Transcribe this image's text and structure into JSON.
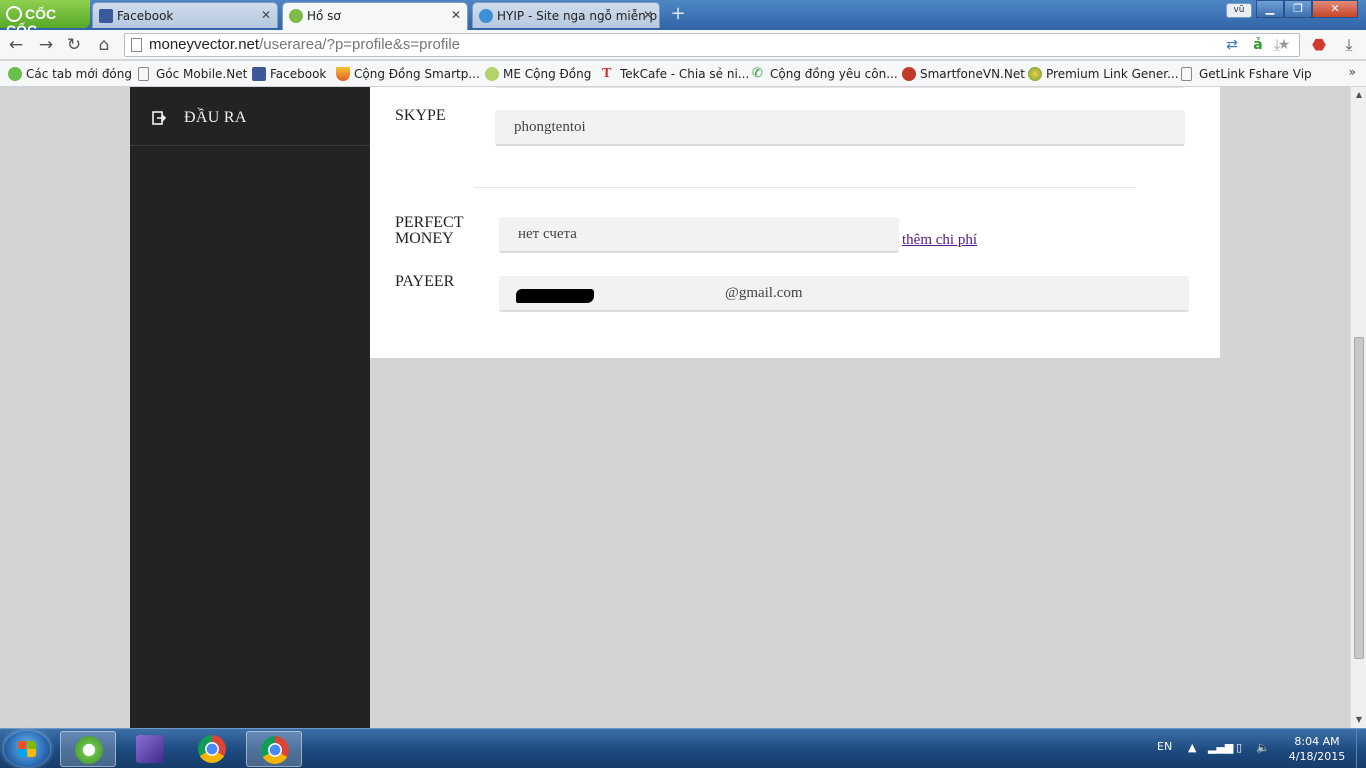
{
  "browser": {
    "brand": "CỐC CỐC",
    "tabs": [
      {
        "label": "Facebook",
        "active": false
      },
      {
        "label": "Hồ sơ",
        "active": true
      },
      {
        "label": "HYIP - Site nga ngỗ miễn p",
        "active": false
      }
    ],
    "user_chip": "vũ",
    "address": {
      "host": "moneyvector.net",
      "path": "/userarea/?p=profile&s=profile"
    },
    "bookmarks": [
      "Các tab mới đóng",
      "Góc Mobile.Net",
      "Facebook",
      "Cộng Đồng Smartp...",
      "ME Cộng Đồng",
      "TekCafe - Chia sẻ ni...",
      "Cộng đồng yêu côn...",
      "SmartfoneVN.Net",
      "Premium Link Gener...",
      "GetLink Fshare Vip"
    ]
  },
  "sidebar": {
    "logout_label": "ĐẦU RA"
  },
  "profile": {
    "skype": {
      "label": "SKYPE",
      "value": "phongtentoi"
    },
    "perfect_money": {
      "label_line1": "PERFECT",
      "label_line2": "MONEY",
      "value": "нет счета",
      "link": "thêm chi phí"
    },
    "payeer": {
      "label": "PAYEER",
      "value": "@gmail.com"
    }
  },
  "taskbar": {
    "language": "EN",
    "time": "8:04 AM",
    "date": "4/18/2015"
  }
}
